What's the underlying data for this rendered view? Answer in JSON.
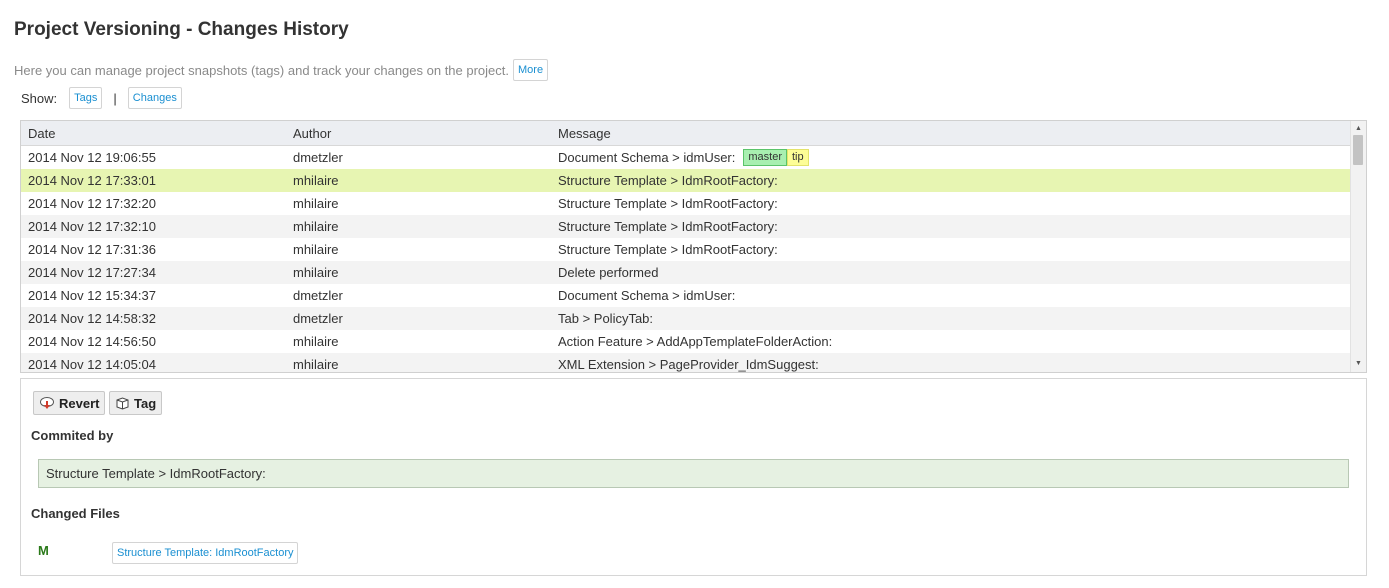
{
  "page": {
    "title": "Project Versioning - Changes History",
    "intro": "Here you can manage project snapshots (tags) and track your changes on the project.",
    "more_label": "More"
  },
  "show": {
    "label": "Show:",
    "tags_label": "Tags",
    "separator": "|",
    "changes_label": "Changes"
  },
  "grid": {
    "columns": [
      "Date",
      "Author",
      "Message"
    ],
    "rows": [
      {
        "date": "2014 Nov 12 19:06:55",
        "author": "dmetzler",
        "message": "Document Schema > idmUser:",
        "badges": [
          "master",
          "tip"
        ]
      },
      {
        "date": "2014 Nov 12 17:33:01",
        "author": "mhilaire",
        "message": "Structure Template > IdmRootFactory:"
      },
      {
        "date": "2014 Nov 12 17:32:20",
        "author": "mhilaire",
        "message": "Structure Template > IdmRootFactory:"
      },
      {
        "date": "2014 Nov 12 17:32:10",
        "author": "mhilaire",
        "message": "Structure Template > IdmRootFactory:"
      },
      {
        "date": "2014 Nov 12 17:31:36",
        "author": "mhilaire",
        "message": "Structure Template > IdmRootFactory:"
      },
      {
        "date": "2014 Nov 12 17:27:34",
        "author": "mhilaire",
        "message": "Delete performed"
      },
      {
        "date": "2014 Nov 12 15:34:37",
        "author": "dmetzler",
        "message": "Document Schema > idmUser:"
      },
      {
        "date": "2014 Nov 12 14:58:32",
        "author": "dmetzler",
        "message": "Tab > PolicyTab:"
      },
      {
        "date": "2014 Nov 12 14:56:50",
        "author": "mhilaire",
        "message": "Action Feature > AddAppTemplateFolderAction:"
      },
      {
        "date": "2014 Nov 12 14:05:04",
        "author": "mhilaire",
        "message": "XML Extension > PageProvider_IdmSuggest:"
      }
    ],
    "selected_row": 1,
    "selected_color": "#e7f5b2"
  },
  "details": {
    "revert_label": "Revert",
    "tag_label": "Tag",
    "committed_by_title": "Commited by",
    "commit_message": "Structure Template > IdmRootFactory:",
    "changed_files_title": "Changed Files",
    "files": [
      {
        "status": "M",
        "name": "Structure Template: IdmRootFactory"
      }
    ]
  },
  "colors": {
    "link": "#1a8fd1",
    "master_badge": "#a8efb0",
    "tip_badge": "#fdfd96",
    "commit_box": "#e6f1e2",
    "modified_status": "#2b7a1a"
  }
}
